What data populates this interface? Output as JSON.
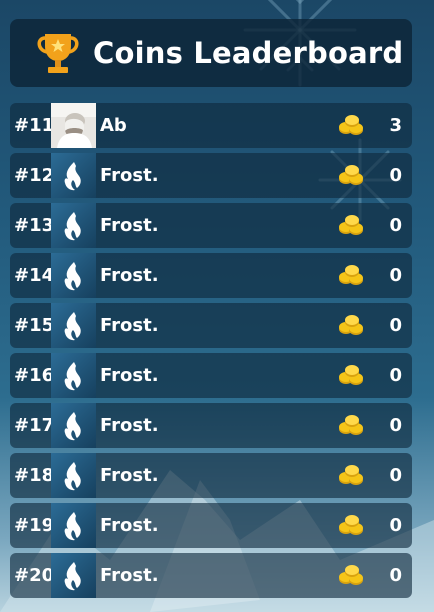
{
  "header": {
    "title": "Coins Leaderboard",
    "icon": "trophy-icon"
  },
  "colors": {
    "row_bg": "#0e283c",
    "header_bg": "#0c2234",
    "trophy": "#f2a21b",
    "coin": "#f5c518",
    "text": "#ffffff"
  },
  "leaderboard": [
    {
      "rank": "#11",
      "name": "Ab",
      "score": "3",
      "avatar": "photo-avatar"
    },
    {
      "rank": "#12",
      "name": "Frost.",
      "score": "0",
      "avatar": "frost-flame-icon"
    },
    {
      "rank": "#13",
      "name": "Frost.",
      "score": "0",
      "avatar": "frost-flame-icon"
    },
    {
      "rank": "#14",
      "name": "Frost.",
      "score": "0",
      "avatar": "frost-flame-icon"
    },
    {
      "rank": "#15",
      "name": "Frost.",
      "score": "0",
      "avatar": "frost-flame-icon"
    },
    {
      "rank": "#16",
      "name": "Frost.",
      "score": "0",
      "avatar": "frost-flame-icon"
    },
    {
      "rank": "#17",
      "name": "Frost.",
      "score": "0",
      "avatar": "frost-flame-icon"
    },
    {
      "rank": "#18",
      "name": "Frost.",
      "score": "0",
      "avatar": "frost-flame-icon"
    },
    {
      "rank": "#19",
      "name": "Frost.",
      "score": "0",
      "avatar": "frost-flame-icon"
    },
    {
      "rank": "#20",
      "name": "Frost.",
      "score": "0",
      "avatar": "frost-flame-icon"
    }
  ]
}
